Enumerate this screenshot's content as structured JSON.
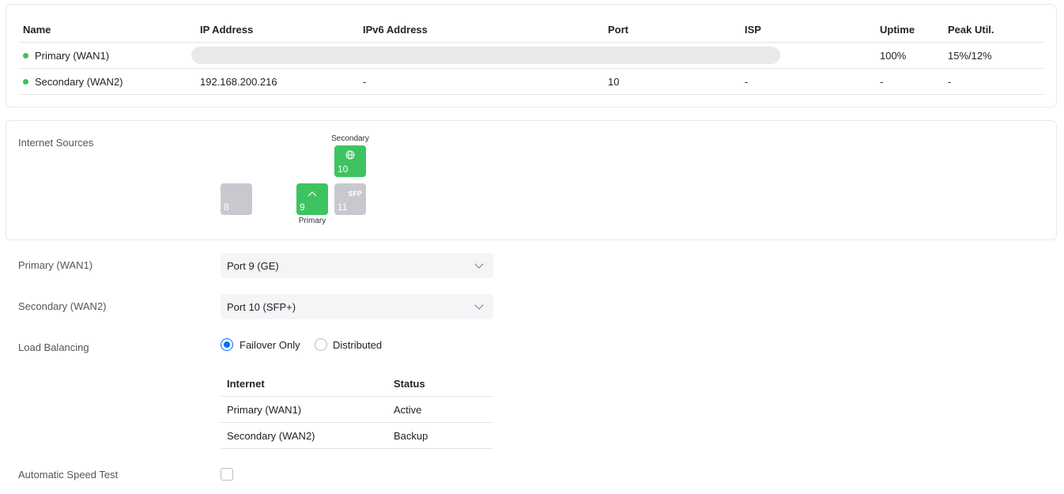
{
  "wan_table": {
    "headers": {
      "name": "Name",
      "ip": "IP Address",
      "ipv6": "IPv6 Address",
      "port": "Port",
      "isp": "ISP",
      "uptime": "Uptime",
      "peak": "Peak Util."
    },
    "rows": [
      {
        "name": "Primary (WAN1)",
        "status_color": "#39c35d",
        "ip": "",
        "ipv6": "",
        "port": "",
        "isp": "",
        "uptime": "100%",
        "peak": "15%/12%",
        "loading": true
      },
      {
        "name": "Secondary (WAN2)",
        "status_color": "#39c35d",
        "ip": "192.168.200.216",
        "ipv6": "-",
        "port": "10",
        "isp": "-",
        "uptime": "-",
        "peak": "-"
      }
    ]
  },
  "internet_sources": {
    "label": "Internet Sources",
    "ports": [
      {
        "number": "8",
        "state": "inactive"
      },
      {
        "number": "9",
        "state": "active",
        "icon": "chevron-up-icon",
        "glyph": "^",
        "caption": "Primary"
      },
      {
        "number": "10",
        "state": "active",
        "icon": "globe-icon",
        "caption": "Secondary"
      },
      {
        "number": "11",
        "state": "inactive",
        "badge": "SFP"
      }
    ]
  },
  "form": {
    "primary": {
      "label": "Primary (WAN1)",
      "value": "Port 9 (GE)"
    },
    "secondary": {
      "label": "Secondary (WAN2)",
      "value": "Port 10 (SFP+)"
    },
    "load_balancing": {
      "label": "Load Balancing",
      "options": [
        {
          "label": "Failover Only",
          "selected": true
        },
        {
          "label": "Distributed",
          "selected": false
        }
      ]
    },
    "status_table": {
      "headers": {
        "internet": "Internet",
        "status": "Status"
      },
      "rows": [
        {
          "internet": "Primary (WAN1)",
          "status": "Active"
        },
        {
          "internet": "Secondary (WAN2)",
          "status": "Backup"
        }
      ]
    },
    "speed_test": {
      "label": "Automatic Speed Test",
      "checked": false
    }
  },
  "colors": {
    "accent": "#006fff",
    "online": "#39c35d",
    "port_active": "#3dc35f",
    "port_inactive": "#c7c9ce"
  }
}
